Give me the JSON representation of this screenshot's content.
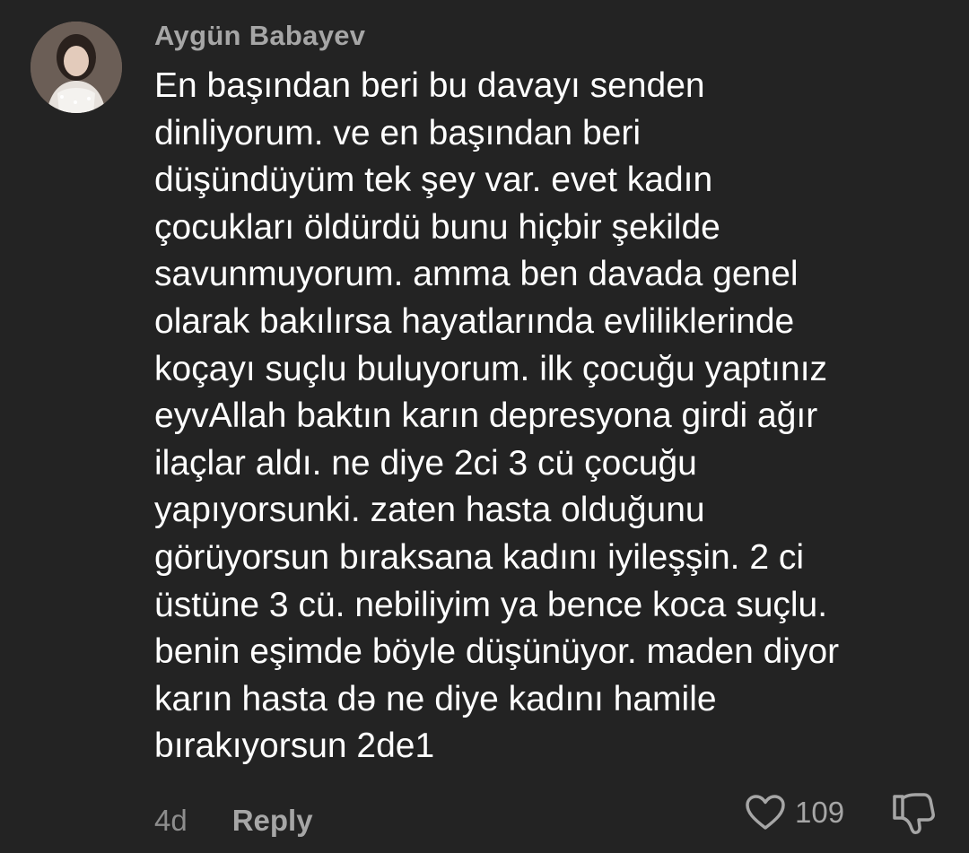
{
  "comment": {
    "author": "Aygün Babayev",
    "avatar_icon": "user-avatar-photo",
    "text": "En başından beri bu davayı senden\ndinliyorum. ve en başından beri\ndüşündüyüm tek şey var. evet kadın\nçocukları öldürdü bunu hiçbir şekilde\nsavunmuyorum. amma ben davada genel\nolarak bakılırsa hayatlarında evliliklerinde\nkoçayı suçlu buluyorum. ilk çocuğu yaptınız\neyvAllah baktın karın depresyona girdi ağır\nilaçlar aldı. ne diye 2ci 3 cü çocuğu\nyapıyorsunki. zaten hasta olduğunu\ngörüyorsun bıraksana kadını iyileşşin. 2 ci\nüstüne 3 cü. nebiliyim ya bence koca suçlu.\nbenin eşimde böyle düşünüyor. maden diyor\nkarın hasta də ne diye kadını hamile\nbırakıyorsun 2de1",
    "time": "4d",
    "reply_label": "Reply",
    "like_count": "109",
    "like_icon": "heart-icon",
    "dislike_icon": "thumbs-down-icon"
  },
  "colors": {
    "background": "#232323",
    "author": "#a6a6a6",
    "text": "#ffffff",
    "meta": "#8d8d8d"
  }
}
